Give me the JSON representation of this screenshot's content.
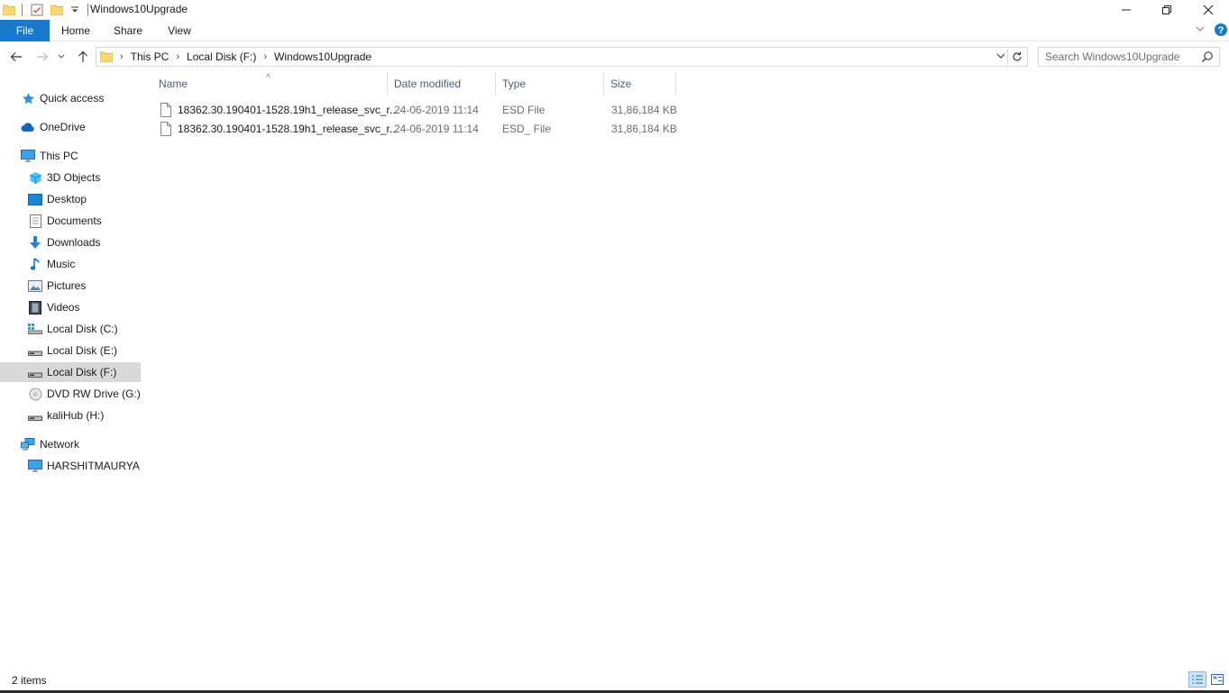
{
  "window": {
    "title": "Windows10Upgrade",
    "controls": {
      "minimize": "—",
      "maximize": "❐",
      "close": "✕"
    }
  },
  "ribbon": {
    "tabs": [
      {
        "label": "File"
      },
      {
        "label": "Home"
      },
      {
        "label": "Share"
      },
      {
        "label": "View"
      }
    ],
    "expand": "⌄",
    "help": "?"
  },
  "address": {
    "crumbs": [
      "This PC",
      "Local Disk (F:)",
      "Windows10Upgrade"
    ],
    "separator": "›"
  },
  "search": {
    "placeholder": "Search Windows10Upgrade"
  },
  "sidebar": {
    "items": [
      {
        "label": "Quick access",
        "icon": "star-icon"
      },
      {
        "label": "OneDrive",
        "icon": "cloud-icon"
      },
      {
        "label": "This PC",
        "icon": "computer-icon"
      },
      {
        "label": "3D Objects",
        "icon": "cube-icon"
      },
      {
        "label": "Desktop",
        "icon": "desktop-icon"
      },
      {
        "label": "Documents",
        "icon": "document-icon"
      },
      {
        "label": "Downloads",
        "icon": "download-icon"
      },
      {
        "label": "Music",
        "icon": "music-icon"
      },
      {
        "label": "Pictures",
        "icon": "pictures-icon"
      },
      {
        "label": "Videos",
        "icon": "video-icon"
      },
      {
        "label": "Local Disk (C:)",
        "icon": "windows-drive-icon"
      },
      {
        "label": "Local Disk (E:)",
        "icon": "drive-icon"
      },
      {
        "label": "Local Disk (F:)",
        "icon": "drive-icon"
      },
      {
        "label": "DVD RW Drive (G:) N",
        "icon": "dvd-icon"
      },
      {
        "label": "kaliHub (H:)",
        "icon": "drive-icon"
      },
      {
        "label": "Network",
        "icon": "network-icon"
      },
      {
        "label": "HARSHITMAURYA",
        "icon": "computer-icon"
      }
    ]
  },
  "columns": {
    "name": "Name",
    "date": "Date modified",
    "type": "Type",
    "size": "Size",
    "sort_arrow": "^"
  },
  "files": [
    {
      "name": "18362.30.190401-1528.19h1_release_svc_r...",
      "date": "24-06-2019 11:14",
      "type": "ESD File",
      "size": "31,86,184 KB"
    },
    {
      "name": "18362.30.190401-1528.19h1_release_svc_r...",
      "date": "24-06-2019 11:14",
      "type": "ESD_ File",
      "size": "31,86,184 KB"
    }
  ],
  "status": {
    "items_count": "2 items"
  },
  "colors": {
    "accent": "#1979ca",
    "selected_bg": "#d9d9d9",
    "column_header": "#4c607a",
    "secondary_text": "#6d6d6d"
  }
}
